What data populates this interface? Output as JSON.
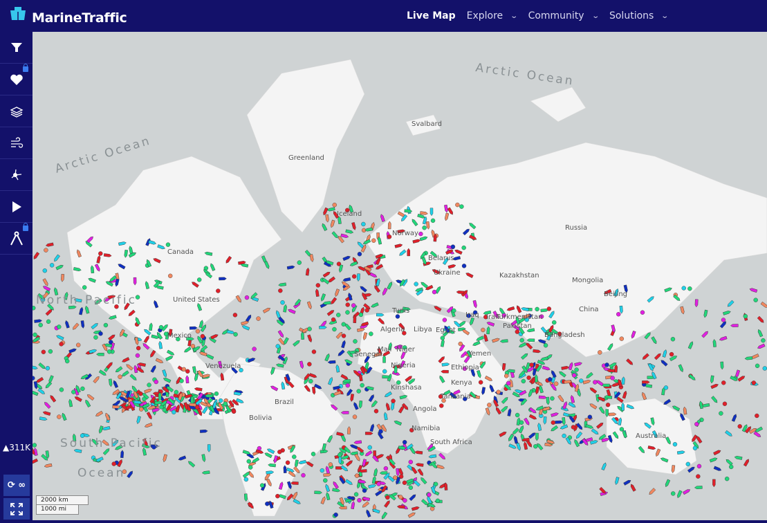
{
  "header": {
    "brand": "MarineTraffic",
    "nav": [
      {
        "label": "Live Map",
        "active": true
      },
      {
        "label": "Explore"
      },
      {
        "label": "Community"
      },
      {
        "label": "Solutions"
      }
    ]
  },
  "sidebar": {
    "buttons": [
      {
        "name": "filter-icon"
      },
      {
        "name": "heart-icon",
        "locked": true
      },
      {
        "name": "layers-icon"
      },
      {
        "name": "wind-icon"
      },
      {
        "name": "network-icon"
      },
      {
        "name": "play-icon"
      },
      {
        "name": "compass-icon",
        "locked": true
      }
    ],
    "vessel_count": "311K",
    "refresh_label": "∞"
  },
  "map": {
    "oceans": [
      {
        "t": "Arctic Ocean"
      },
      {
        "t": "Arctic Ocean"
      },
      {
        "t": "South Pacific"
      },
      {
        "t": "Ocean"
      },
      {
        "t": "North Pacific"
      }
    ],
    "labels": [
      "Svalbard",
      "Greenland",
      "Iceland",
      "Norway",
      "Canada",
      "United States",
      "Mexico",
      "Venezuela",
      "Brazil",
      "Bolivia",
      "Russia",
      "Belarus",
      "Ukraine",
      "Kazakhstan",
      "Mongolia",
      "Turkmenistan",
      "China",
      "Beijing",
      "Iraq",
      "Iran",
      "Pakistan",
      "Bangladesh",
      "Tunis",
      "Algeria",
      "Libya",
      "Egypt",
      "Mali",
      "Niger",
      "Senegal",
      "Nigeria",
      "Ethiopia",
      "Yemen",
      "Kenya",
      "Kinshasa",
      "Tanzania",
      "Angola",
      "Namibia",
      "South Africa",
      "Australia"
    ],
    "scale": {
      "km": "2000 km",
      "mi": "1000 mi"
    }
  },
  "colors": {
    "header": "#13116a",
    "land": "#f4f4f4",
    "sea": "#cfd3d4",
    "cargo": "#22d67a",
    "tanker": "#e0202a",
    "passenger": "#1030c0",
    "pleasure": "#e020e0",
    "fishing": "#f08860",
    "tug": "#20d0e8"
  }
}
